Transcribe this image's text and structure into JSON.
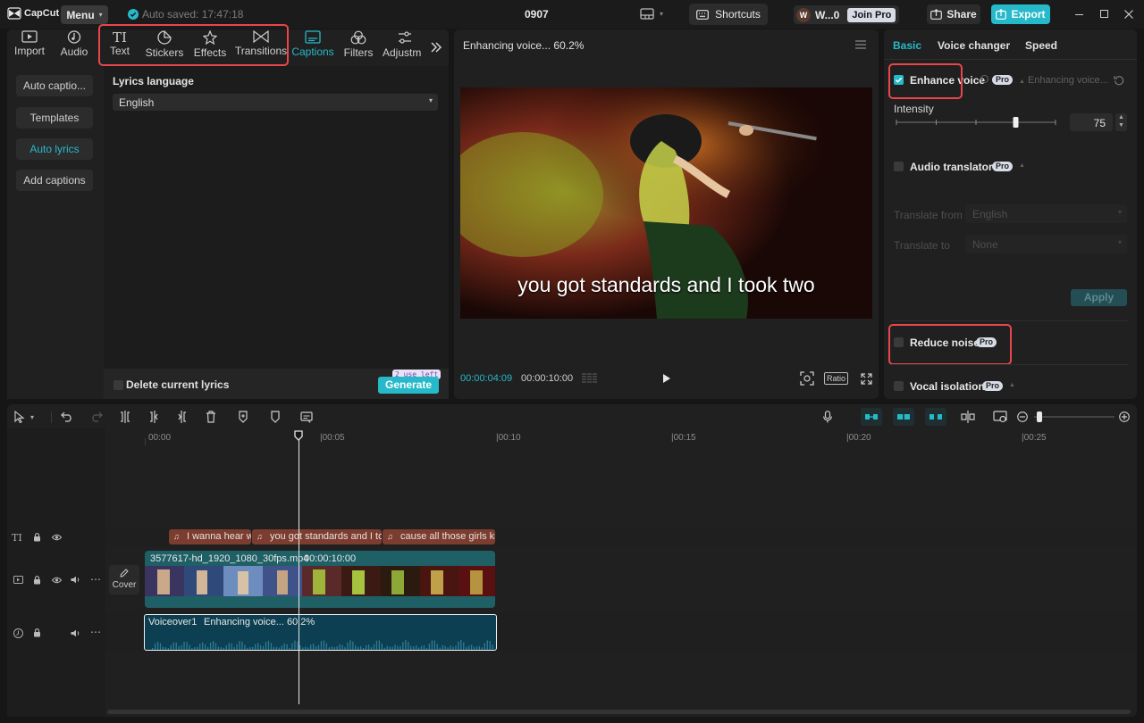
{
  "titlebar": {
    "logo": "CapCut",
    "menu_label": "Menu",
    "autosave": "Auto saved: 17:47:18",
    "project_name": "0907",
    "shortcuts_label": "Shortcuts",
    "account_initial": "W",
    "account_name": "W...0",
    "join_pro_label": "Join Pro",
    "share_label": "Share",
    "export_label": "Export"
  },
  "toolbar": {
    "tools": [
      {
        "label": "Import",
        "icon": "import-icon"
      },
      {
        "label": "Audio",
        "icon": "audio-icon"
      },
      {
        "label": "Text",
        "icon": "text-icon"
      },
      {
        "label": "Stickers",
        "icon": "stickers-icon"
      },
      {
        "label": "Effects",
        "icon": "effects-icon"
      },
      {
        "label": "Transitions",
        "icon": "transitions-icon"
      },
      {
        "label": "Captions",
        "icon": "captions-icon",
        "active": true
      },
      {
        "label": "Filters",
        "icon": "filters-icon"
      },
      {
        "label": "Adjustm",
        "icon": "adjustment-icon"
      }
    ],
    "more_icon": "chevron-double-right-icon"
  },
  "captions_panel": {
    "side_buttons": [
      "Auto captio...",
      "Templates",
      "Auto lyrics",
      "Add captions"
    ],
    "active_side": "Auto lyrics",
    "lyrics_language_label": "Lyrics language",
    "lyrics_language_value": "English",
    "delete_lyrics_label": "Delete current lyrics",
    "uses_left": "2 use left",
    "generate_label": "Generate"
  },
  "player": {
    "status": "Enhancing voice... 60.2%",
    "caption_overlay": "you got standards and I took two",
    "current_time": "00:00:04:09",
    "total_time": "00:00:10:00",
    "ratio_label": "Ratio"
  },
  "right_panel": {
    "tabs": [
      "Basic",
      "Voice changer",
      "Speed"
    ],
    "active_tab": "Basic",
    "enhance_voice_label": "Enhance voice",
    "enhance_voice_checked": true,
    "enhance_status": "Enhancing voice...",
    "pro_badge": "Pro",
    "intensity_label": "Intensity",
    "intensity_value": "75",
    "intensity_fraction": 0.75,
    "audio_translator_label": "Audio translator",
    "translate_from_label": "Translate from",
    "translate_from_value": "English",
    "translate_to_label": "Translate to",
    "translate_to_value": "None",
    "apply_label": "Apply",
    "reduce_noise_label": "Reduce noise",
    "vocal_isolation_label": "Vocal isolation"
  },
  "timeline": {
    "ruler": [
      "00:00",
      "|00:05",
      "|00:10",
      "|00:15",
      "|00:20",
      "|00:25"
    ],
    "caption_clips": [
      "I wanna hear wl",
      "you got standards and I to",
      "cause all those girls kno"
    ],
    "video_clip_name": "3577617-hd_1920_1080_30fps.mp4",
    "video_clip_duration": "00:00:10:00",
    "cover_label": "Cover",
    "audio_clip_name": "Voiceover1",
    "audio_clip_status": "Enhancing voice... 60.2%"
  },
  "colors": {
    "accent": "#26b9c9",
    "highlight_box": "#e8464b",
    "caption_clip": "#7c3d31",
    "video_clip": "#1f5f66",
    "audio_clip": "#0c3f52"
  }
}
